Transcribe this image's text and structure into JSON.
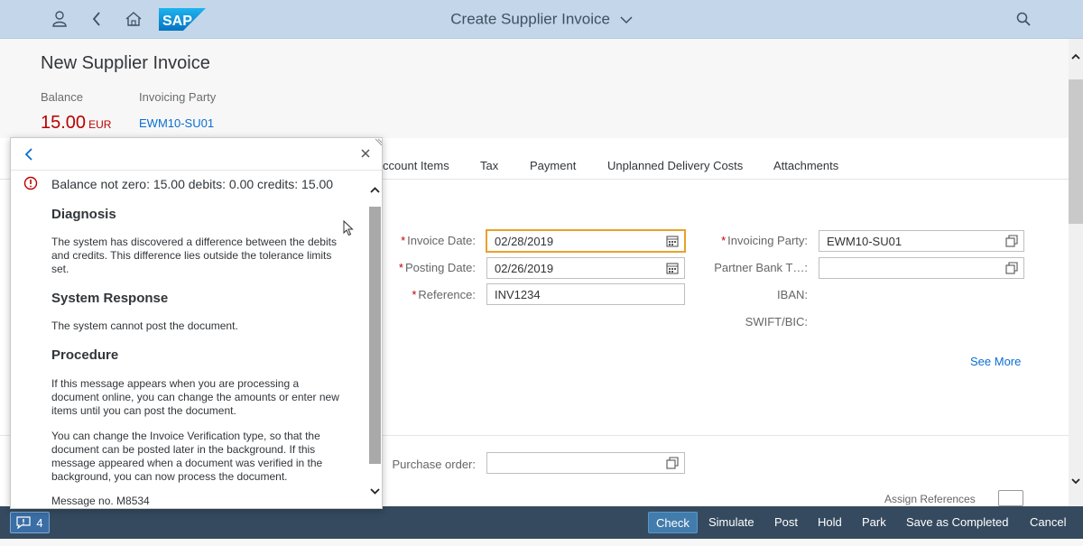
{
  "shell": {
    "title": "Create Supplier Invoice",
    "logo_text": "SAP",
    "icons": [
      "user-icon",
      "back-icon",
      "home-icon",
      "search-icon"
    ]
  },
  "header": {
    "title": "New Supplier Invoice",
    "balance_label": "Balance",
    "balance_value": "15.00",
    "balance_currency": "EUR",
    "party_label": "Invoicing Party",
    "party_value": "EWM10-SU01"
  },
  "tabs": [
    "ccount Items",
    "Tax",
    "Payment",
    "Unplanned Delivery Costs",
    "Attachments"
  ],
  "form": {
    "invoice_date_label": "Invoice Date:",
    "invoice_date": "02/28/2019",
    "posting_date_label": "Posting Date:",
    "posting_date": "02/26/2019",
    "reference_label": "Reference:",
    "reference": "INV1234",
    "invoicing_party_label": "Invoicing Party:",
    "invoicing_party": "EWM10-SU01",
    "partner_bank_label": "Partner Bank T…:",
    "partner_bank": "",
    "iban_label": "IBAN:",
    "swift_label": "SWIFT/BIC:",
    "see_more": "See More",
    "purchase_order_label": "Purchase order:",
    "purchase_order": "",
    "assign_references": "Assign References"
  },
  "popover": {
    "message": "Balance not zero: 15.00 debits: 0.00 credits: 15.00",
    "diagnosis_title": "Diagnosis",
    "diagnosis_text": "The system has discovered a difference between the debits and credits. This difference lies outside the tolerance limits set.",
    "response_title": "System Response",
    "response_text": "The system cannot post the document.",
    "procedure_title": "Procedure",
    "procedure_text_1": "If this message appears when you are processing a document online, you can change the amounts or enter new items until you can post the document.",
    "procedure_text_2": "You can change the Invoice Verification type, so that the document can be posted later in the background. If this message appeared when a document was verified in the background, you can now process the document.",
    "message_no": "Message no. M8534"
  },
  "footer": {
    "message_count": "4",
    "buttons": [
      "Check",
      "Simulate",
      "Post",
      "Hold",
      "Park",
      "Save as Completed",
      "Cancel"
    ]
  },
  "colors": {
    "shell_bg": "#c3d6ea",
    "footer_bg": "#354a5f",
    "error": "#bb0000",
    "link": "#0a6ed1",
    "focus": "#e9a12a"
  }
}
